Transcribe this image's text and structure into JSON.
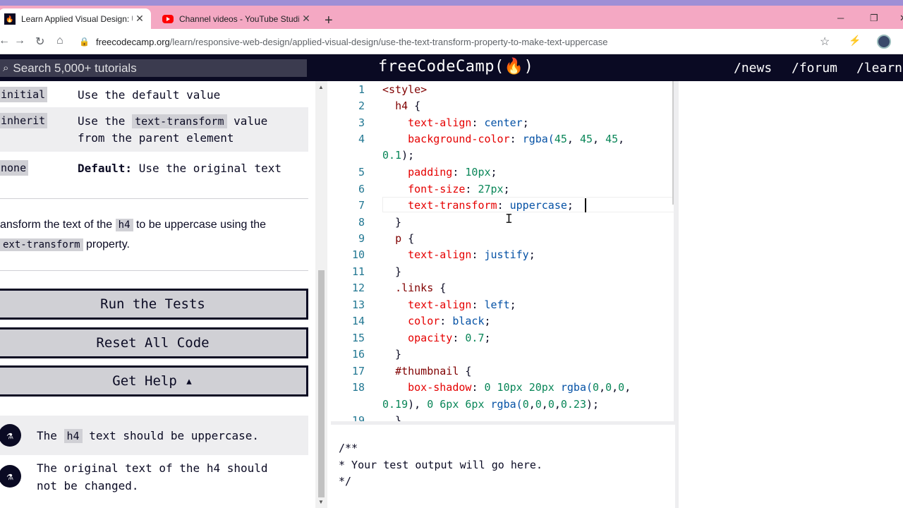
{
  "browser": {
    "tabs": [
      {
        "title": "Learn Applied Visual Design: Use",
        "active": true
      },
      {
        "title": "Channel videos - YouTube Studio",
        "active": false
      }
    ],
    "new_tab_icon": "+",
    "url_domain": "freecodecamp.org",
    "url_path": "/learn/responsive-web-design/applied-visual-design/use-the-text-transform-property-to-make-text-uppercase"
  },
  "nav": {
    "search_placeholder": "Search 5,000+ tutorials",
    "brand": "freeCodeCamp(🔥)",
    "links": [
      "/news",
      "/forum",
      "/learn"
    ]
  },
  "table": {
    "rows": [
      {
        "key": "initial",
        "value": "Use the default value"
      },
      {
        "key": "inherit",
        "value_pre": "Use the ",
        "value_code": "text-transform",
        "value_post": " value",
        "value_line2": "from the parent element"
      },
      {
        "key": "none",
        "value_bold": "Default:",
        "value": " Use the original text"
      }
    ]
  },
  "description": {
    "line1_pre": "ansform the text of the ",
    "line1_code": "h4",
    "line1_post": " to be uppercase using the",
    "line2_code": "ext-transform",
    "line2_post": " property."
  },
  "buttons": {
    "run": "Run the Tests",
    "reset": "Reset All Code",
    "help": "Get Help ▴"
  },
  "tests": [
    {
      "pre": "The ",
      "code": "h4",
      "post": " text should be uppercase."
    },
    {
      "line1": "The original text of the h4 should",
      "line2": "not be changed."
    }
  ],
  "editor": {
    "line_numbers": [
      "1",
      "2",
      "3",
      "4",
      "",
      "5",
      "6",
      "7",
      "8",
      "9",
      "10",
      "11",
      "12",
      "13",
      "14",
      "15",
      "16",
      "17",
      "18",
      "",
      "19"
    ]
  },
  "output": {
    "line1": "/**",
    "line2": "* Your test output will go here.",
    "line3": "*/"
  }
}
